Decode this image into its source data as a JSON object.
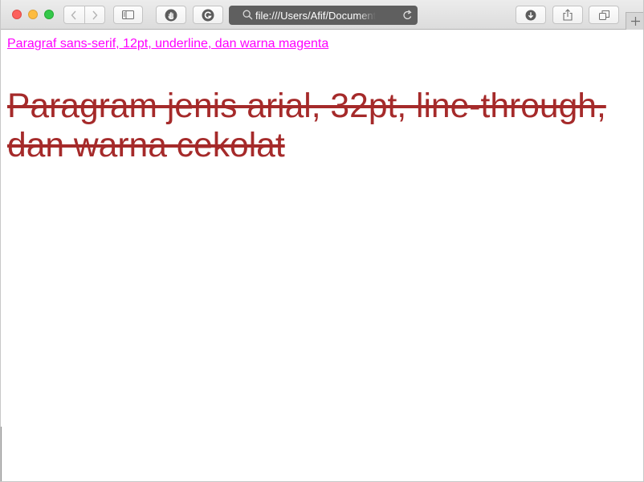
{
  "browser": {
    "address_url": "file:///Users/Afif/Document"
  },
  "page": {
    "paragraph_small": {
      "text": "Paragraf sans-serif, 12pt, underline, dan warna magenta",
      "color": "#ff00ff"
    },
    "paragraph_large": {
      "text": "Paragram jenis arial, 32pt, line-through, dan warna cekolat",
      "color": "#a52a2a"
    }
  },
  "icons": {
    "close": "close-window-icon",
    "minimize": "minimize-window-icon",
    "maximize": "maximize-window-icon",
    "back": "chevron-left-icon",
    "forward": "chevron-right-icon",
    "sidebar": "sidebar-icon",
    "privacy": "hand-stop-icon",
    "extension": "grammarly-g-icon",
    "search": "magnifier-icon",
    "reload": "reload-icon",
    "download": "download-icon",
    "share": "share-icon",
    "tabs": "tab-overview-icon",
    "new_tab": "plus-icon"
  }
}
